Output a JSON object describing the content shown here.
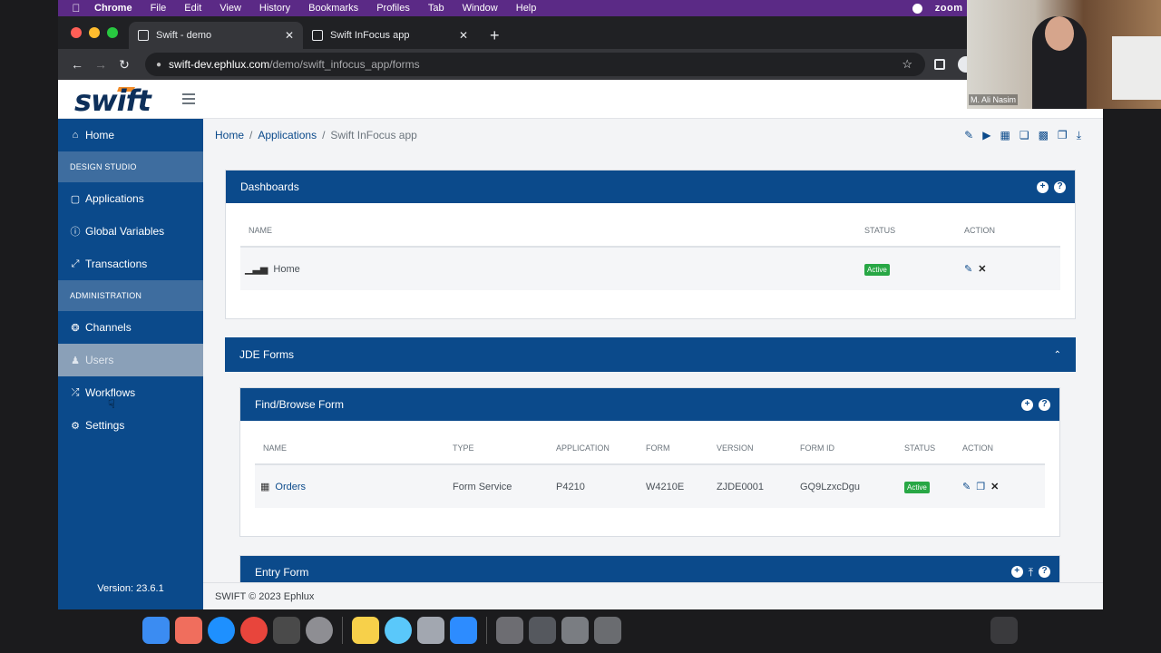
{
  "menubar": {
    "app": "Chrome",
    "items": [
      "File",
      "Edit",
      "View",
      "History",
      "Bookmarks",
      "Profiles",
      "Tab",
      "Window",
      "Help"
    ],
    "zoom_label": "zoom"
  },
  "tabs": [
    {
      "title": "Swift - demo"
    },
    {
      "title": "Swift InFocus app"
    }
  ],
  "address": {
    "host": "swift-dev.ephlux.com",
    "path": "/demo/swift_infocus_app/forms"
  },
  "sidebar": {
    "home": "Home",
    "section_design": "DESIGN STUDIO",
    "applications": "Applications",
    "global_variables": "Global Variables",
    "transactions": "Transactions",
    "section_admin": "ADMINISTRATION",
    "channels": "Channels",
    "users": "Users",
    "workflows": "Workflows",
    "settings": "Settings",
    "version": "Version: 23.6.1"
  },
  "breadcrumb": {
    "home": "Home",
    "applications": "Applications",
    "current": "Swift InFocus app"
  },
  "dashboards": {
    "title": "Dashboards",
    "headers": {
      "name": "NAME",
      "status": "STATUS",
      "action": "ACTION"
    },
    "row": {
      "name": "Home",
      "status": "Active"
    }
  },
  "jde": {
    "title": "JDE Forms"
  },
  "find_browse": {
    "title": "Find/Browse Form",
    "headers": {
      "name": "NAME",
      "type": "TYPE",
      "application": "APPLICATION",
      "form": "FORM",
      "version": "VERSION",
      "form_id": "FORM ID",
      "status": "STATUS",
      "action": "ACTION"
    },
    "row": {
      "name": "Orders",
      "type": "Form Service",
      "application": "P4210",
      "form": "W4210E",
      "version": "ZJDE0001",
      "form_id": "GQ9LzxcDgu",
      "status": "Active"
    }
  },
  "entry_form": {
    "title": "Entry Form"
  },
  "footer": "SWIFT © 2023 Ephlux",
  "video": {
    "participant": "M. Ali Nasim"
  },
  "colors": {
    "primary": "#0b4a8b",
    "status_active": "#28a745",
    "menubar": "#5b2a86",
    "logo_accent": "#f28c28"
  }
}
